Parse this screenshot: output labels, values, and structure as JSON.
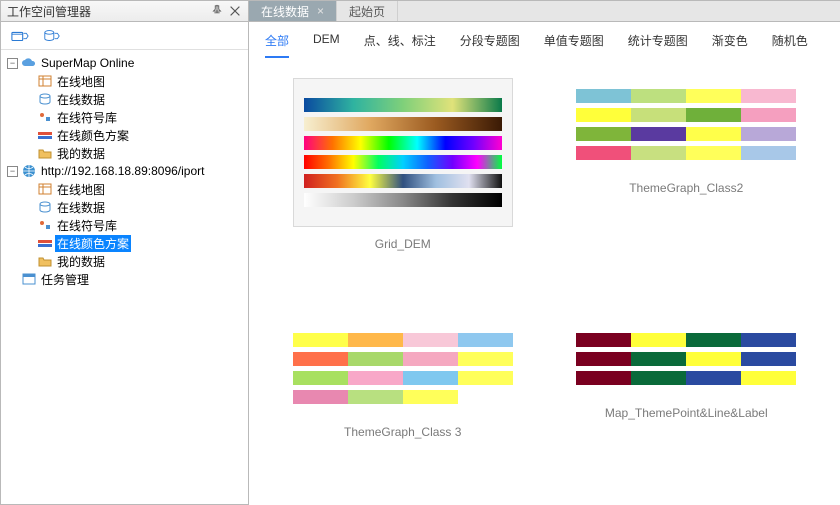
{
  "panel": {
    "title": "工作空间管理器"
  },
  "tabs": [
    {
      "label": "在线数据",
      "active": true,
      "closable": true
    },
    {
      "label": "起始页",
      "active": false,
      "closable": false
    }
  ],
  "tree": {
    "root1": {
      "label": "SuperMap Online",
      "children": [
        "在线地图",
        "在线数据",
        "在线符号库",
        "在线颜色方案",
        "我的数据"
      ]
    },
    "root2": {
      "label": "http://192.168.18.89:8096/iport",
      "children": [
        "在线地图",
        "在线数据",
        "在线符号库",
        "在线颜色方案",
        "我的数据"
      ]
    },
    "tasks": "任务管理",
    "selected": "在线颜色方案"
  },
  "filters": [
    "全部",
    "DEM",
    "点、线、标注",
    "分段专题图",
    "单值专题图",
    "统计专题图",
    "渐变色",
    "随机色"
  ],
  "filter_active": 0,
  "cards": {
    "c0": "Grid_DEM",
    "c1": "ThemeGraph_Class2",
    "c2": "ThemeGraph_Class 3",
    "c3": "Map_ThemePoint&Line&Label"
  },
  "palettes": {
    "grid_dem": [
      "linear-gradient(90deg,#0a4aa0,#2fb3a0,#7fd07a,#e0e27a,#0a7a4a)",
      "linear-gradient(90deg,#f7efd0,#e0a860,#9a5a20,#3a1a05)",
      "linear-gradient(90deg,#ff0080,#ff7000,#ffff00,#00ff00,#00ffff,#0000ff,#7000ff,#ff00d0)",
      "linear-gradient(90deg,#ff0000,#ff7000,#ffff00,#00ff60,#00d0ff,#1060ff,#7000ff,#ff00ff,#00ff40)",
      "linear-gradient(90deg,#d02020,#f07020,#ffff40,#305080,#a0c0e0,#e0e0f0,#101010)",
      "linear-gradient(90deg,#ffffff,#cccccc,#888888,#333333,#000000)"
    ],
    "theme2": [
      [
        "#7ec3d6",
        "#bde07f",
        "#ffff5a",
        "#f8b8d0"
      ],
      [
        "#ffff3a",
        "#c7e07a",
        "#6fb03a",
        "#f59fbf"
      ],
      [
        "#7fb53a",
        "#5a3aa0",
        "#ffff4a",
        "#b8a8d8"
      ],
      [
        "#f0507a",
        "#c8e080",
        "#ffff5a",
        "#a8c8e8"
      ]
    ],
    "theme3": [
      [
        "#ffff4a",
        "#ffb84a",
        "#f8c8d8",
        "#8fc8ef"
      ],
      [
        "#ff704a",
        "#a8d86a",
        "#f5a8c0",
        "#ffff5a"
      ],
      [
        "#a8e060",
        "#f8a8c8",
        "#7fc8ef",
        "#ffff5a"
      ],
      [
        "#e888b0",
        "#b8e080",
        "#ffff5a",
        "#ffffff"
      ]
    ],
    "mappt": [
      [
        "#7a0020",
        "#ffff3a",
        "#0a6a3a",
        "#2a4aa0"
      ],
      [
        "#7a0020",
        "#0a6a3a",
        "#ffff3a",
        "#2a4aa0"
      ],
      [
        "#7a0020",
        "#0a6a3a",
        "#2a4aa0",
        "#ffff3a"
      ]
    ]
  }
}
